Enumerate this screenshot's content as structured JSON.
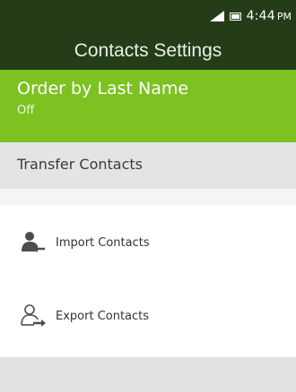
{
  "status_bar": {
    "time": "4:44",
    "ampm": "PM",
    "signal_icon": "signal-icon",
    "battery_icon": "battery-icon"
  },
  "header": {
    "title": "Contacts Settings"
  },
  "order_setting": {
    "label": "Order by Last Name",
    "value": "Off"
  },
  "transfer_section": {
    "label": "Transfer Contacts"
  },
  "items": [
    {
      "label": "Import Contacts",
      "icon": "import-contacts-icon"
    },
    {
      "label": "Export Contacts",
      "icon": "export-contacts-icon"
    }
  ],
  "colors": {
    "header_bg": "#243d18",
    "accent_green": "#7cc221",
    "section_bg": "#e4e4e4"
  }
}
